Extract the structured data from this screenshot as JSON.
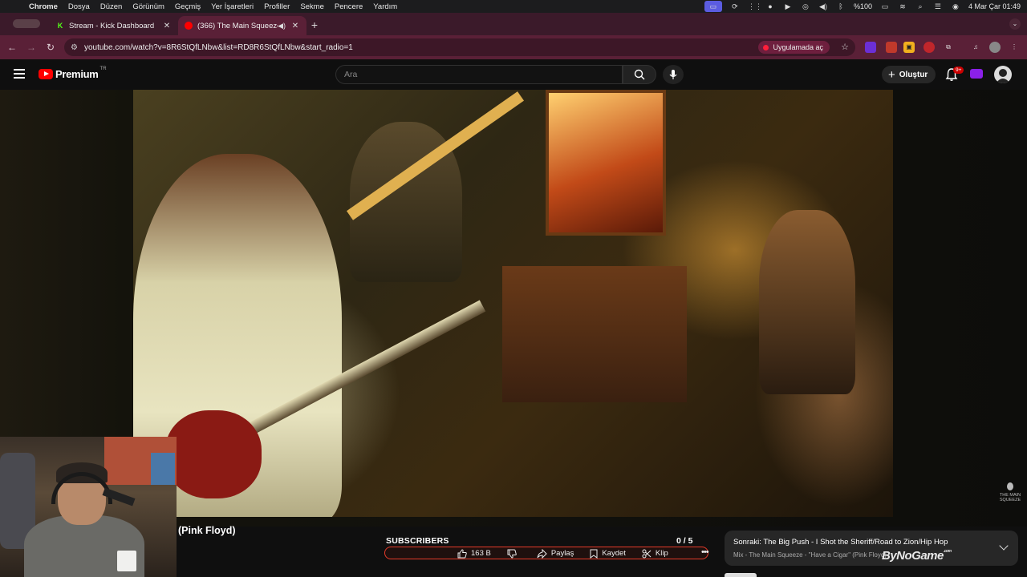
{
  "menubar": {
    "app": "Chrome",
    "items": [
      "Dosya",
      "Düzen",
      "Görünüm",
      "Geçmiş",
      "Yer İşaretleri",
      "Profiller",
      "Sekme",
      "Pencere",
      "Yardım"
    ],
    "battery": "%100",
    "datetime": "4 Mar Çar  01:49"
  },
  "tabs": [
    {
      "title": "Stream - Kick Dashboard",
      "favicon": "kick-icon",
      "color": "#53fc18"
    },
    {
      "title": "(366) The Main Squeeze",
      "favicon": "youtube-icon",
      "color": "#ff0000"
    }
  ],
  "address": {
    "url": "youtube.com/watch?v=8R6StQfLNbw&list=RD8R6StQfLNbw&start_radio=1",
    "open_in_app": "Uygulamada aç"
  },
  "youtube": {
    "logo_text": "Premium",
    "country_code": "TR",
    "search_placeholder": "Ara",
    "create_label": "Oluştur",
    "notification_badge": "9+"
  },
  "video": {
    "title_fragment": "(Pink Floyd)",
    "watermark": "THE MAIN SQUEEZE"
  },
  "overlay": {
    "subscribers_label": "SUBSCRIBERS",
    "subscribers_count": "0  / 5"
  },
  "actions": {
    "likes": "163 B",
    "share": "Paylaş",
    "save": "Kaydet",
    "clip": "Klip"
  },
  "upnext": {
    "title": "Sonraki: The Big Push - I Shot the Sheriff/Road to Zion/Hip Hop",
    "subtitle": "Mix - The Main Squeeze - \"Have a Cigar\" (Pink Floyd)"
  },
  "brand_logo": "ByNoGame",
  "brand_logo_suffix": ".com"
}
